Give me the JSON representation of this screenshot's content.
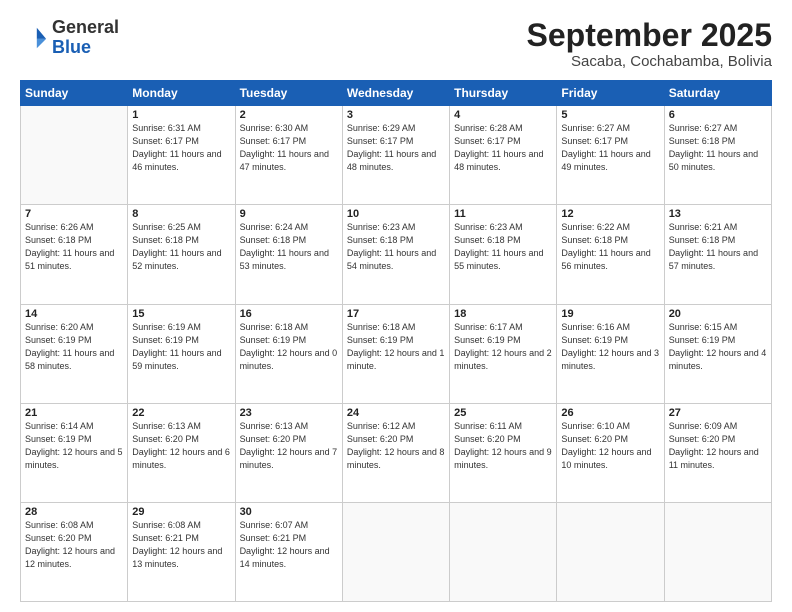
{
  "header": {
    "logo_general": "General",
    "logo_blue": "Blue",
    "month": "September 2025",
    "location": "Sacaba, Cochabamba, Bolivia"
  },
  "days_of_week": [
    "Sunday",
    "Monday",
    "Tuesday",
    "Wednesday",
    "Thursday",
    "Friday",
    "Saturday"
  ],
  "weeks": [
    [
      {
        "day": "",
        "sunrise": "",
        "sunset": "",
        "daylight": ""
      },
      {
        "day": "1",
        "sunrise": "Sunrise: 6:31 AM",
        "sunset": "Sunset: 6:17 PM",
        "daylight": "Daylight: 11 hours and 46 minutes."
      },
      {
        "day": "2",
        "sunrise": "Sunrise: 6:30 AM",
        "sunset": "Sunset: 6:17 PM",
        "daylight": "Daylight: 11 hours and 47 minutes."
      },
      {
        "day": "3",
        "sunrise": "Sunrise: 6:29 AM",
        "sunset": "Sunset: 6:17 PM",
        "daylight": "Daylight: 11 hours and 48 minutes."
      },
      {
        "day": "4",
        "sunrise": "Sunrise: 6:28 AM",
        "sunset": "Sunset: 6:17 PM",
        "daylight": "Daylight: 11 hours and 48 minutes."
      },
      {
        "day": "5",
        "sunrise": "Sunrise: 6:27 AM",
        "sunset": "Sunset: 6:17 PM",
        "daylight": "Daylight: 11 hours and 49 minutes."
      },
      {
        "day": "6",
        "sunrise": "Sunrise: 6:27 AM",
        "sunset": "Sunset: 6:18 PM",
        "daylight": "Daylight: 11 hours and 50 minutes."
      }
    ],
    [
      {
        "day": "7",
        "sunrise": "Sunrise: 6:26 AM",
        "sunset": "Sunset: 6:18 PM",
        "daylight": "Daylight: 11 hours and 51 minutes."
      },
      {
        "day": "8",
        "sunrise": "Sunrise: 6:25 AM",
        "sunset": "Sunset: 6:18 PM",
        "daylight": "Daylight: 11 hours and 52 minutes."
      },
      {
        "day": "9",
        "sunrise": "Sunrise: 6:24 AM",
        "sunset": "Sunset: 6:18 PM",
        "daylight": "Daylight: 11 hours and 53 minutes."
      },
      {
        "day": "10",
        "sunrise": "Sunrise: 6:23 AM",
        "sunset": "Sunset: 6:18 PM",
        "daylight": "Daylight: 11 hours and 54 minutes."
      },
      {
        "day": "11",
        "sunrise": "Sunrise: 6:23 AM",
        "sunset": "Sunset: 6:18 PM",
        "daylight": "Daylight: 11 hours and 55 minutes."
      },
      {
        "day": "12",
        "sunrise": "Sunrise: 6:22 AM",
        "sunset": "Sunset: 6:18 PM",
        "daylight": "Daylight: 11 hours and 56 minutes."
      },
      {
        "day": "13",
        "sunrise": "Sunrise: 6:21 AM",
        "sunset": "Sunset: 6:18 PM",
        "daylight": "Daylight: 11 hours and 57 minutes."
      }
    ],
    [
      {
        "day": "14",
        "sunrise": "Sunrise: 6:20 AM",
        "sunset": "Sunset: 6:19 PM",
        "daylight": "Daylight: 11 hours and 58 minutes."
      },
      {
        "day": "15",
        "sunrise": "Sunrise: 6:19 AM",
        "sunset": "Sunset: 6:19 PM",
        "daylight": "Daylight: 11 hours and 59 minutes."
      },
      {
        "day": "16",
        "sunrise": "Sunrise: 6:18 AM",
        "sunset": "Sunset: 6:19 PM",
        "daylight": "Daylight: 12 hours and 0 minutes."
      },
      {
        "day": "17",
        "sunrise": "Sunrise: 6:18 AM",
        "sunset": "Sunset: 6:19 PM",
        "daylight": "Daylight: 12 hours and 1 minute."
      },
      {
        "day": "18",
        "sunrise": "Sunrise: 6:17 AM",
        "sunset": "Sunset: 6:19 PM",
        "daylight": "Daylight: 12 hours and 2 minutes."
      },
      {
        "day": "19",
        "sunrise": "Sunrise: 6:16 AM",
        "sunset": "Sunset: 6:19 PM",
        "daylight": "Daylight: 12 hours and 3 minutes."
      },
      {
        "day": "20",
        "sunrise": "Sunrise: 6:15 AM",
        "sunset": "Sunset: 6:19 PM",
        "daylight": "Daylight: 12 hours and 4 minutes."
      }
    ],
    [
      {
        "day": "21",
        "sunrise": "Sunrise: 6:14 AM",
        "sunset": "Sunset: 6:19 PM",
        "daylight": "Daylight: 12 hours and 5 minutes."
      },
      {
        "day": "22",
        "sunrise": "Sunrise: 6:13 AM",
        "sunset": "Sunset: 6:20 PM",
        "daylight": "Daylight: 12 hours and 6 minutes."
      },
      {
        "day": "23",
        "sunrise": "Sunrise: 6:13 AM",
        "sunset": "Sunset: 6:20 PM",
        "daylight": "Daylight: 12 hours and 7 minutes."
      },
      {
        "day": "24",
        "sunrise": "Sunrise: 6:12 AM",
        "sunset": "Sunset: 6:20 PM",
        "daylight": "Daylight: 12 hours and 8 minutes."
      },
      {
        "day": "25",
        "sunrise": "Sunrise: 6:11 AM",
        "sunset": "Sunset: 6:20 PM",
        "daylight": "Daylight: 12 hours and 9 minutes."
      },
      {
        "day": "26",
        "sunrise": "Sunrise: 6:10 AM",
        "sunset": "Sunset: 6:20 PM",
        "daylight": "Daylight: 12 hours and 10 minutes."
      },
      {
        "day": "27",
        "sunrise": "Sunrise: 6:09 AM",
        "sunset": "Sunset: 6:20 PM",
        "daylight": "Daylight: 12 hours and 11 minutes."
      }
    ],
    [
      {
        "day": "28",
        "sunrise": "Sunrise: 6:08 AM",
        "sunset": "Sunset: 6:20 PM",
        "daylight": "Daylight: 12 hours and 12 minutes."
      },
      {
        "day": "29",
        "sunrise": "Sunrise: 6:08 AM",
        "sunset": "Sunset: 6:21 PM",
        "daylight": "Daylight: 12 hours and 13 minutes."
      },
      {
        "day": "30",
        "sunrise": "Sunrise: 6:07 AM",
        "sunset": "Sunset: 6:21 PM",
        "daylight": "Daylight: 12 hours and 14 minutes."
      },
      {
        "day": "",
        "sunrise": "",
        "sunset": "",
        "daylight": ""
      },
      {
        "day": "",
        "sunrise": "",
        "sunset": "",
        "daylight": ""
      },
      {
        "day": "",
        "sunrise": "",
        "sunset": "",
        "daylight": ""
      },
      {
        "day": "",
        "sunrise": "",
        "sunset": "",
        "daylight": ""
      }
    ]
  ]
}
